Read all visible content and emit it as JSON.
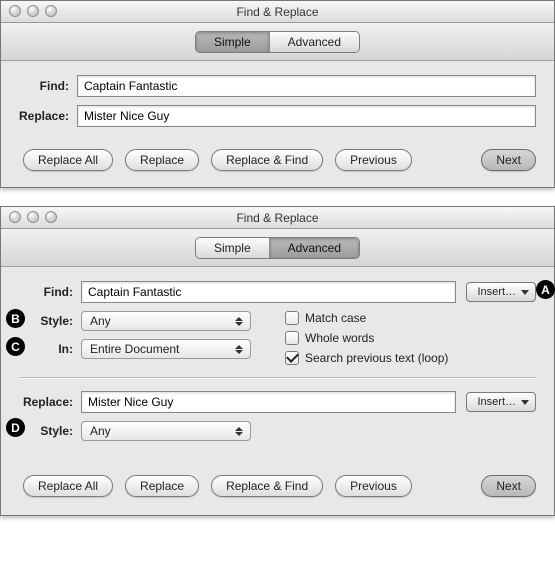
{
  "window_title": "Find & Replace",
  "tabs": {
    "simple": "Simple",
    "advanced": "Advanced"
  },
  "simple": {
    "find_label": "Find:",
    "find_value": "Captain Fantastic",
    "replace_label": "Replace:",
    "replace_value": "Mister Nice Guy"
  },
  "buttons": {
    "replace_all": "Replace All",
    "replace": "Replace",
    "replace_find": "Replace & Find",
    "previous": "Previous",
    "next": "Next"
  },
  "advanced": {
    "find_label": "Find:",
    "find_value": "Captain Fantastic",
    "insert_label": "Insert…",
    "style_label": "Style:",
    "style_value1": "Any",
    "in_label": "In:",
    "in_value": "Entire Document",
    "match_case": "Match case",
    "whole_words": "Whole words",
    "search_prev": "Search previous text (loop)",
    "replace_label": "Replace:",
    "replace_value": "Mister Nice Guy",
    "style_value2": "Any"
  },
  "callouts": {
    "a": "A",
    "b": "B",
    "c": "C",
    "d": "D"
  }
}
